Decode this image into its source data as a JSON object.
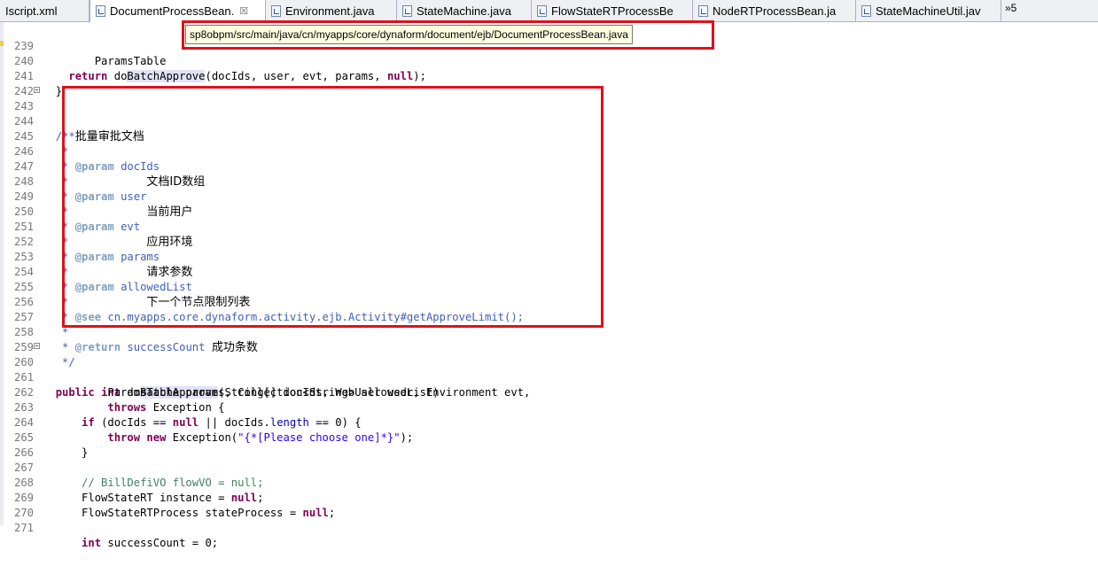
{
  "tabs": [
    {
      "label": "Iscript.xml"
    },
    {
      "label": "DocumentProcessBean.",
      "close": "☒"
    },
    {
      "label": "Environment.java"
    },
    {
      "label": "StateMachine.java"
    },
    {
      "label": "FlowStateRTProcessBe"
    },
    {
      "label": "NodeRTProcessBean.ja"
    },
    {
      "label": "StateMachineUtil.jav"
    }
  ],
  "tab_overflow": "»5",
  "tooltip": "sp8obpm/src/main/java/cn/myapps/core/dynaform/document/ejb/DocumentProcessBean.java",
  "editor": {
    "lines": {
      "239": "239",
      "240": "240",
      "241": "241",
      "242": "242",
      "243": "243",
      "244": "244",
      "245": "245",
      "246": "246",
      "247": "247",
      "248": "248",
      "249": "249",
      "250": "250",
      "251": "251",
      "252": "252",
      "253": "253",
      "254": "254",
      "255": "255",
      "256": "256",
      "257": "257",
      "258": "258",
      "259": "259",
      "260": "260",
      "261": "261",
      "262": "262",
      "263": "263",
      "264": "264",
      "265": "265",
      "266": "266",
      "267": "267",
      "268": "268",
      "269": "269",
      "270": "270",
      "271": "271"
    },
    "t": {
      "l239": "ParamsTable",
      "l240_return": "return",
      "l240_do": "do",
      "l240_hl": "BatchApprove",
      "l240_args": "(docIds, user, evt, params, ",
      "l240_null": "null",
      "l240_end": ");",
      "l241": "}",
      "l243": "/**",
      "star": "*",
      "l244": "批量审批文档",
      "param": "@param",
      "l246_name": "docIds",
      "l247_desc": "文档ID数组",
      "l248_name": "user",
      "l249_desc": "当前用户",
      "l250_name": "evt",
      "l251_desc": "应用环境",
      "l252_name": "params",
      "l253_desc": "请求参数",
      "l254_name": "allowedList",
      "l255_desc": "下一个节点限制列表",
      "see": "@see",
      "l256_ref": "cn.myapps.core.dynaform.activity.ejb.Activity#getApproveLimit();",
      "return_tag": "@return",
      "l258_name": "successCount",
      "l258_desc": "成功条数",
      "l259": "*/",
      "public": "public",
      "int": "int",
      "l260_do": "do",
      "l260_hl": "BatchApprove",
      "l260_rest": "(String[] docIds, WebUser user, Environment evt,",
      "l261": "ParamsTable params, Collection<String> allowedList)",
      "throws": "throws",
      "l262_rest": "Exception {",
      "if": "if",
      "l263_a": "(docIds == ",
      "null": "null",
      "l263_b": " || docIds.",
      "length": "length",
      "l263_c": " == 0) {",
      "throw": "throw",
      "new": "new",
      "l264_a": "Exception(",
      "l264_str": "\"{*[Please choose one]*}\"",
      "l264_end": ");",
      "l265": "}",
      "l267": "// BillDefiVO flowVO = null;",
      "l268_a": "FlowStateRT instance = ",
      "l269_a": "FlowStateRTProcess stateProcess = ",
      "semi": ";",
      "l271_rest": " successCount = 0;"
    }
  },
  "colors": {
    "keyword": "#7f0055",
    "javadoc": "#3f5fbf",
    "javadoc_tag": "#7f9fbf",
    "string": "#2a00ff",
    "comment": "#3f7f5f",
    "annotation_box": "#e0101b",
    "tooltip_bg": "#ffffe1"
  }
}
